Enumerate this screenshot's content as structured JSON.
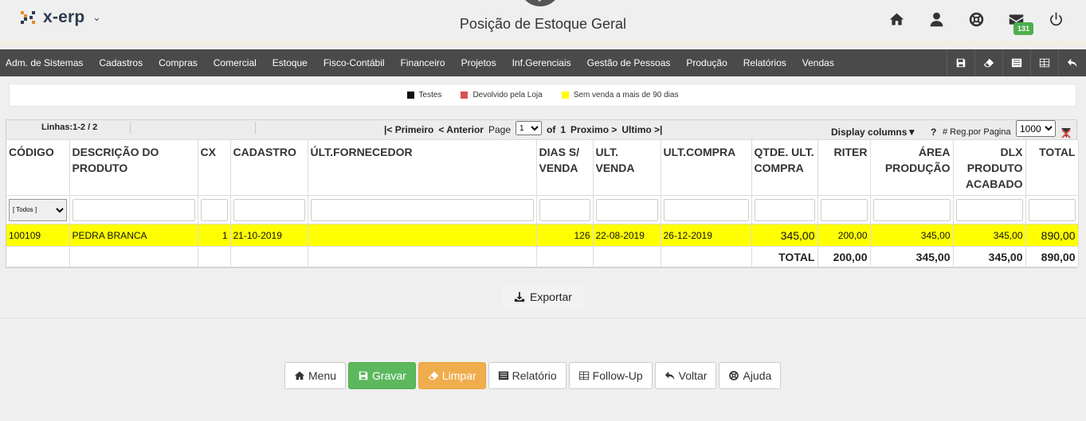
{
  "brand": {
    "name": "x-erp"
  },
  "page": {
    "title": "Posição de Estoque Geral"
  },
  "header": {
    "mail_badge": "131"
  },
  "menu": [
    "Adm. de Sistemas",
    "Cadastros",
    "Compras",
    "Comercial",
    "Estoque",
    "Fisco-Contábil",
    "Financeiro",
    "Projetos",
    "Inf.Gerenciais",
    "Gestão de Pessoas",
    "Produção",
    "Relatórios",
    "Vendas"
  ],
  "legend": [
    {
      "label": "Testes",
      "color": "#111111"
    },
    {
      "label": "Devolvido pela Loja",
      "color": "#d9534f"
    },
    {
      "label": "Sem venda a mais de 90 dias",
      "color": "#ffff00"
    }
  ],
  "pager": {
    "lines": "Linhas:1-2 / 2",
    "first": "|< Primeiro",
    "prev": "< Anterior",
    "page_label": "Page",
    "page_value": "1",
    "of_label": "of",
    "total_pages": "1",
    "next": "Proximo >",
    "last": "Ultimo >|",
    "display_columns": "Display columns▼",
    "help": "?",
    "per_page_label": "# Reg.por Pagina",
    "per_page_value": "1000"
  },
  "filter": {
    "todos": "[ Todos ]"
  },
  "columns": [
    {
      "label": "CÓDIGO",
      "align": "left"
    },
    {
      "label": "DESCRIÇÃO DO PRODUTO",
      "align": "left"
    },
    {
      "label": "CX",
      "align": "left"
    },
    {
      "label": "CADASTRO",
      "align": "left"
    },
    {
      "label": "ÚLT.FORNECEDOR",
      "align": "left"
    },
    {
      "label": "DIAS S/ VENDA",
      "align": "left"
    },
    {
      "label": "ULT. VENDA",
      "align": "left"
    },
    {
      "label": "ULT.COMPRA",
      "align": "left"
    },
    {
      "label": "QTDE. ULT. COMPRA",
      "align": "left"
    },
    {
      "label": "RITER",
      "align": "right"
    },
    {
      "label": "ÁREA PRODUÇÃO",
      "align": "right"
    },
    {
      "label": "DLX PRODUTO ACABADO",
      "align": "right"
    },
    {
      "label": "TOTAL",
      "align": "right"
    }
  ],
  "rows": [
    {
      "codigo": "100109",
      "descricao": "PEDRA BRANCA",
      "cx": "1",
      "cadastro": "21-10-2019",
      "fornecedor": "",
      "dias": "126",
      "ult_venda": "22-08-2019",
      "ult_compra": "26-12-2019",
      "qtde": "345,00",
      "riter": "200,00",
      "area": "345,00",
      "dlx": "345,00",
      "total": "890,00"
    }
  ],
  "totals": {
    "label": "TOTAL",
    "riter": "200,00",
    "area": "345,00",
    "dlx": "345,00",
    "total": "890,00"
  },
  "export_label": "Exportar",
  "buttons": {
    "menu": "Menu",
    "gravar": "Gravar",
    "limpar": "Limpar",
    "relatorio": "Relatório",
    "followup": "Follow-Up",
    "voltar": "Voltar",
    "ajuda": "Ajuda"
  }
}
